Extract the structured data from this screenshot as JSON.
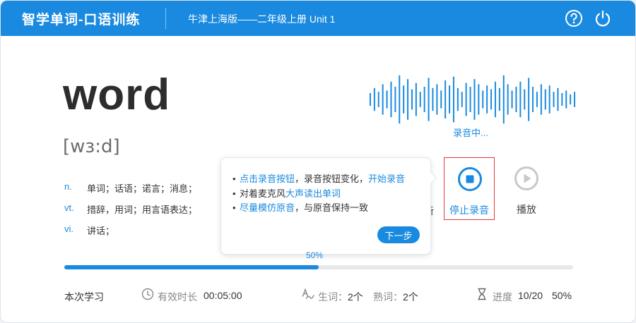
{
  "header": {
    "app_title": "智学单词-口语训练",
    "book_info": "牛津上海版——二年级上册 Unit 1"
  },
  "word": {
    "text": "word",
    "phonetic": "[wɜ:d]",
    "definitions": [
      {
        "pos": "n.",
        "meaning": "单词；话语；诺言；消息；"
      },
      {
        "pos": "vt.",
        "meaning": "措辞，用词；用言语表达；"
      },
      {
        "pos": "vi.",
        "meaning": "讲话；"
      }
    ]
  },
  "recording": {
    "status": "录音中...",
    "wave_levels": [
      0.25,
      0.45,
      0.3,
      0.6,
      0.35,
      0.7,
      0.5,
      0.95,
      0.55,
      0.8,
      0.4,
      0.65,
      0.3,
      0.5,
      0.85,
      0.45,
      0.6,
      0.35,
      0.75,
      0.55,
      0.9,
      0.45,
      0.3,
      0.65,
      0.5,
      0.8,
      0.6,
      0.35,
      0.55,
      0.4,
      0.7,
      0.45,
      0.95,
      0.6,
      0.35,
      0.5,
      0.7,
      0.4,
      0.85,
      0.5,
      0.3,
      0.6,
      0.4,
      0.55,
      0.3,
      0.45,
      0.25,
      0.35,
      0.2,
      0.3
    ]
  },
  "controls": {
    "hidden_label_fragment": "听",
    "stop_label": "停止录音",
    "play_label": "播放"
  },
  "tooltip": {
    "line1": {
      "part1": "点击录音按钮",
      "part2": "，录音按钮变化，",
      "part3": "开始录音"
    },
    "line2": {
      "part1": "对着麦克风",
      "part2": "大声读出单词"
    },
    "line3": {
      "part1": "尽量模仿原音",
      "part2": "，与原音保持一致"
    },
    "bullet": "•",
    "next_label": "下一步"
  },
  "progress": {
    "percent_label": "50%",
    "fraction": 0.5
  },
  "footer": {
    "session_label": "本次学习",
    "duration_label": "有效时长",
    "duration_value": "00:05:00",
    "new_words_label": "生词：",
    "new_words_value": "2个",
    "familiar_label": "熟词：",
    "familiar_value": "2个",
    "progress_label": "进度",
    "progress_value": "10/20",
    "progress_percent": "50%"
  },
  "colors": {
    "accent": "#1a8ae0",
    "highlight_border": "#e03a3a"
  },
  "icons": {
    "help": "help-circle-icon",
    "power": "power-icon",
    "stop": "stop-record-icon",
    "play": "play-icon",
    "clock": "clock-icon",
    "spell": "spell-check-icon",
    "hourglass": "hourglass-icon"
  }
}
